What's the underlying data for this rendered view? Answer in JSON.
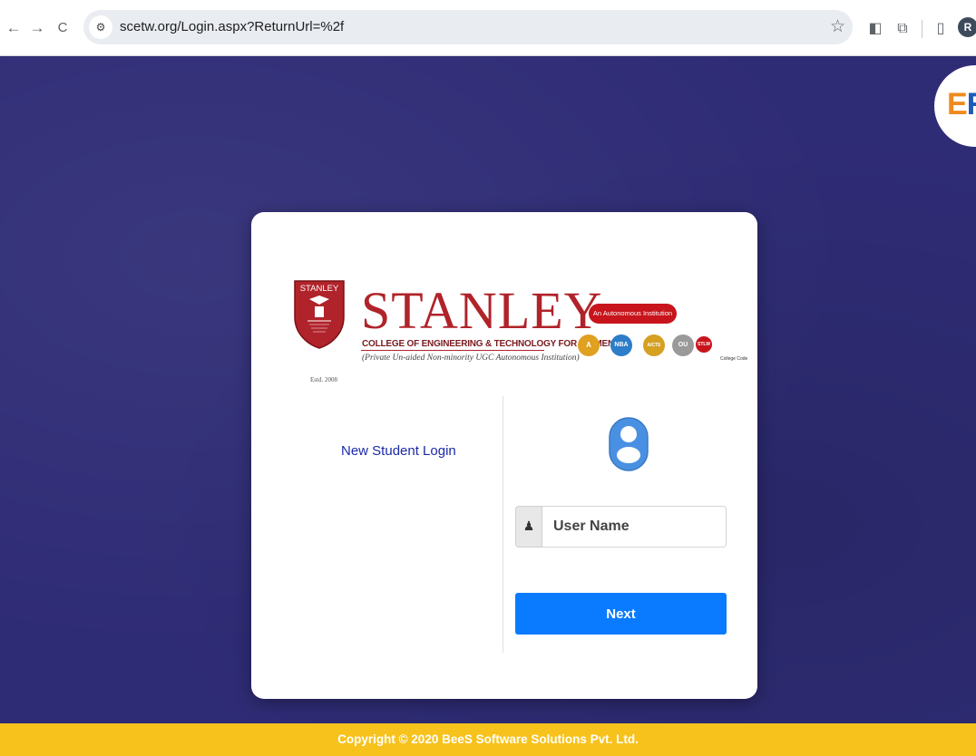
{
  "browser": {
    "back_icon": "←",
    "forward_icon": "→",
    "reload_icon": "C",
    "site_info_icon": "⚙",
    "url": "scetw.org/Login.aspx?ReturnUrl=%2f",
    "bookmark_icon": "☆",
    "extension_icon": "◧",
    "puzzle_icon": "⧉",
    "sidepanel_icon": "▯",
    "profile_initial": "R"
  },
  "badge": {
    "text_orange": "E",
    "text_blue": "R"
  },
  "logo": {
    "crest_text": "STANLEY",
    "estd": "Estd. 2008",
    "name": "STANLEY",
    "college_line": "COLLEGE OF ENGINEERING & TECHNOLOGY FOR WOMEN",
    "tagline": "(Private Un-aided Non-minority UGC Autonomous Institution)",
    "autonomous_pill": "An Autonomous Institution",
    "accreditations": [
      "A",
      "NBA",
      "AICTE",
      "OU",
      "STLW"
    ],
    "college_code_label": "College Code"
  },
  "login": {
    "new_student_link": "New Student Login",
    "username_placeholder": "User Name",
    "username_value": "",
    "user_addon_icon": "♟",
    "next_label": "Next"
  },
  "footer": {
    "copyright": "Copyright © 2020 BeeS Software Solutions Pvt. Ltd."
  },
  "colors": {
    "background": "#2f2c76",
    "brand_red": "#b0232a",
    "button_blue": "#0a7bff",
    "footer_yellow": "#f7c21c",
    "link_blue": "#1b2aa8"
  }
}
